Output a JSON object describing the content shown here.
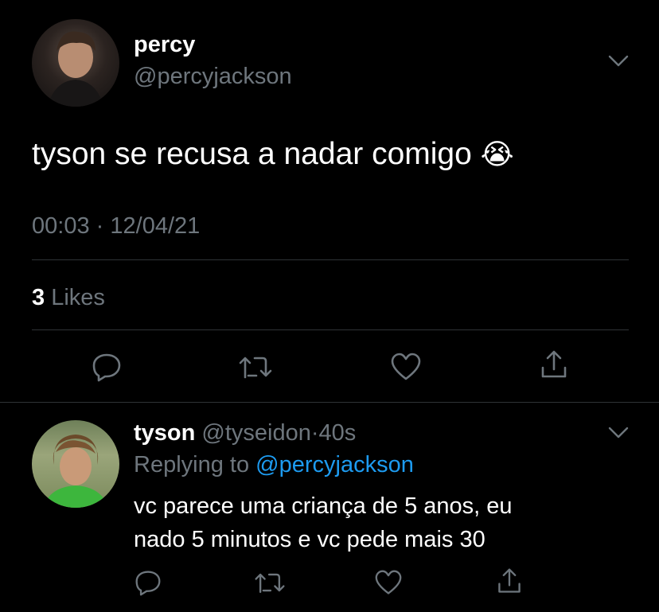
{
  "main_tweet": {
    "display_name": "percy",
    "handle": "@percyjackson",
    "text": "tyson se recusa a nadar comigo",
    "emoji": "😭",
    "time": "00:03",
    "date": "12/04/21",
    "timestamp_sep": "·",
    "likes_count": "3",
    "likes_label": "Likes"
  },
  "reply": {
    "display_name": "tyson",
    "handle": "@tyseidon",
    "sep": "·",
    "age": "40s",
    "replying_prefix": "Replying to",
    "replying_to": "@percyjackson",
    "text_line1": "vc parece uma criança de 5 anos, eu",
    "text_line2": "nado 5 minutos e vc pede mais 30"
  },
  "icons": [
    "chevron-down-icon",
    "reply-icon",
    "retweet-icon",
    "like-icon",
    "share-icon"
  ],
  "colors": {
    "background": "#000000",
    "muted": "#6e767d",
    "link": "#1d9bf0",
    "text": "#ffffff"
  }
}
